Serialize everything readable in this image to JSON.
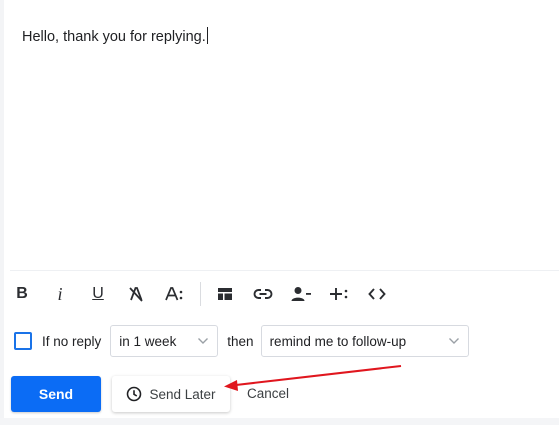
{
  "editor": {
    "body_text": "Hello, thank you for replying."
  },
  "toolbar": {
    "buttons": [
      {
        "icon": "bold-icon"
      },
      {
        "icon": "italic-icon"
      },
      {
        "icon": "underline-icon"
      },
      {
        "icon": "clear-formatting-icon"
      },
      {
        "icon": "font-size-icon"
      },
      {
        "icon": "template-icon"
      },
      {
        "icon": "link-icon"
      },
      {
        "icon": "mention-person-icon"
      },
      {
        "icon": "insert-more-icon"
      },
      {
        "icon": "code-icon"
      }
    ],
    "bold_glyph": "B",
    "italic_glyph": "i",
    "underline_glyph": "U"
  },
  "followup": {
    "checkbox_checked": false,
    "if_no_reply_label": "If no reply",
    "delay_value": "in 1 week",
    "then_label": "then",
    "action_value": "remind me to follow-up"
  },
  "actions": {
    "send_label": "Send",
    "send_later_label": "Send Later",
    "cancel_label": "Cancel"
  },
  "colors": {
    "accent": "#0b6cf5",
    "checkbox": "#1a73e8",
    "annotation_arrow": "#e0161e"
  }
}
